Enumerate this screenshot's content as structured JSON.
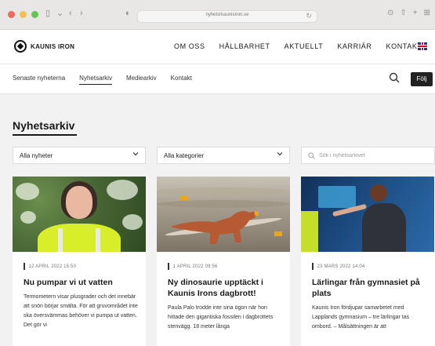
{
  "browser": {
    "url": "nyhetsrkaunisiron.se"
  },
  "header": {
    "logo_text": "KAUNIS IRON",
    "nav": [
      "OM OSS",
      "HÅLLBARHET",
      "AKTUELLT",
      "KARRIÄR",
      "KONTAKT"
    ]
  },
  "subnav": {
    "items": [
      "Senaste nyheterna",
      "Nyhetsarkiv",
      "Mediearkiv",
      "Kontakt"
    ],
    "active": "Nyhetsarkiv",
    "follow_label": "Följ"
  },
  "page": {
    "title": "Nyhetsarkiv"
  },
  "filters": {
    "news": "Alla nyheter",
    "categories": "Alla kategorier",
    "search_placeholder": "Sök i nyhetsarkivet"
  },
  "cards": [
    {
      "date": "12 APRIL 2022 15:50",
      "title": "Nu pumpar vi ut vatten",
      "excerpt": "Termometern visar plusgrader och det innebär att snön börjar smälta. För att gruvområdet inte ska översvämmas behöver vi pumpa ut vatten. Det gör vi"
    },
    {
      "date": "1 APRIL 2022 09:56",
      "title": "Ny dinosaurie upptäckt i Kaunis Irons dagbrott!",
      "excerpt": "Paula Palo trodde inte sina ögon när hon hittade den gigantiska fossilen i dagbrottets stenvägg. 18 meter långa"
    },
    {
      "date": "23 MARS 2022 14:04",
      "title": "Lärlingar från gymnasiet på plats",
      "excerpt": "Kaunis Iron fördjupar samarbetet med Lapplands gymnasium – tre lärlingar tas ombord. – Målsättningen är att"
    }
  ],
  "colors": {
    "accent_dark": "#222222",
    "page_bg": "#f2f2f2"
  }
}
